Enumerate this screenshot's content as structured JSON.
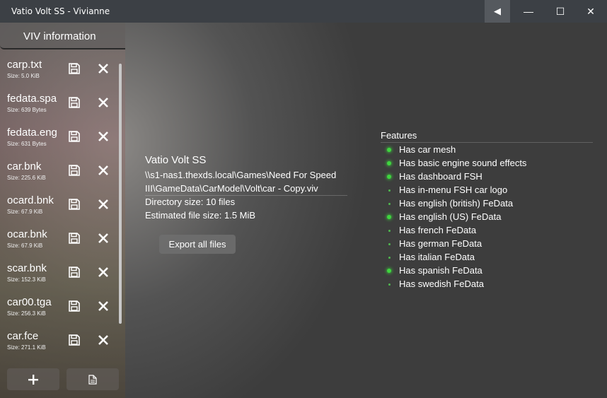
{
  "window": {
    "title": "Vatio Volt SS - Vivianne",
    "back_glyph": "◀",
    "minimize_glyph": "—",
    "maximize_glyph": "☐",
    "close_glyph": "✕"
  },
  "sidebar": {
    "title": "VIV information",
    "files": [
      {
        "name": "carp.txt",
        "size": "Size: 5.0 KiB"
      },
      {
        "name": "fedata.spa",
        "size": "Size: 639 Bytes"
      },
      {
        "name": "fedata.eng",
        "size": "Size: 631 Bytes"
      },
      {
        "name": "car.bnk",
        "size": "Size: 225.6 KiB"
      },
      {
        "name": "ocard.bnk",
        "size": "Size: 67.9 KiB"
      },
      {
        "name": "ocar.bnk",
        "size": "Size: 67.9 KiB"
      },
      {
        "name": "scar.bnk",
        "size": "Size: 152.3 KiB"
      },
      {
        "name": "car00.tga",
        "size": "Size: 256.3 KiB"
      },
      {
        "name": "car.fce",
        "size": "Size: 271.1 KiB"
      }
    ],
    "add_icon": "plus-icon",
    "doc_icon": "document-icon"
  },
  "info": {
    "viv_name": "Vatio Volt SS",
    "path_line1": "\\\\s1-nas1.thexds.local\\Games\\Need For Speed",
    "path_line2": "III\\GameData\\CarModel\\Volt\\car - Copy.viv",
    "directory_size": "Directory size: 10 files",
    "estimated_size": "Estimated file size: 1.5 MiB",
    "export_label": "Export all files"
  },
  "features": {
    "title": "Features",
    "items": [
      {
        "label": "Has car mesh",
        "on": true
      },
      {
        "label": "Has basic engine sound effects",
        "on": true
      },
      {
        "label": "Has dashboard FSH",
        "on": true
      },
      {
        "label": "Has in-menu FSH car logo",
        "on": false
      },
      {
        "label": "Has english (british) FeData",
        "on": false
      },
      {
        "label": "Has english (US) FeData",
        "on": true
      },
      {
        "label": "Has french FeData",
        "on": false
      },
      {
        "label": "Has german FeData",
        "on": false
      },
      {
        "label": "Has italian FeData",
        "on": false
      },
      {
        "label": "Has spanish FeData",
        "on": true
      },
      {
        "label": "Has swedish FeData",
        "on": false
      }
    ]
  },
  "colors": {
    "feature_on": "#3fd63f",
    "feature_off": "#4fb84f",
    "background": "#3d3d3d",
    "titlebar": "#3c4045"
  }
}
